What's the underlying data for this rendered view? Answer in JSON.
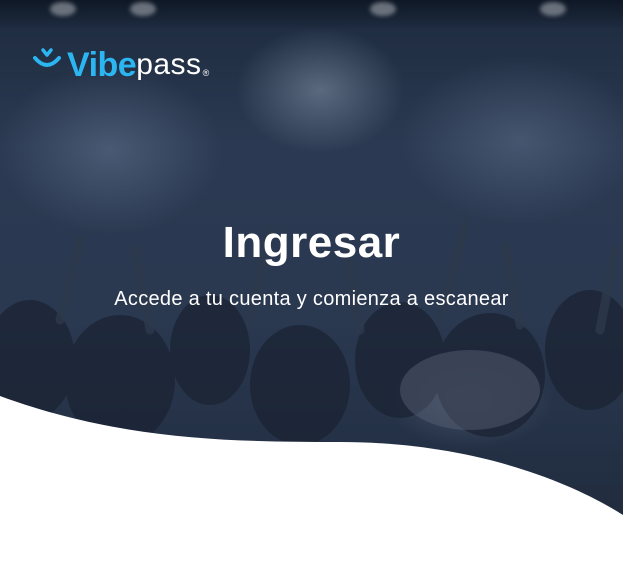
{
  "brand": {
    "name_part1": "Vibe",
    "name_part2": "pass",
    "registered_mark": "®",
    "accent_color": "#2bb6f2"
  },
  "hero": {
    "title": "Ingresar",
    "subtitle": "Accede a tu cuenta y comienza a escanear",
    "background_image": "concert-crowd"
  },
  "icons": {
    "logo_mark": "checkmark-badge-icon"
  }
}
